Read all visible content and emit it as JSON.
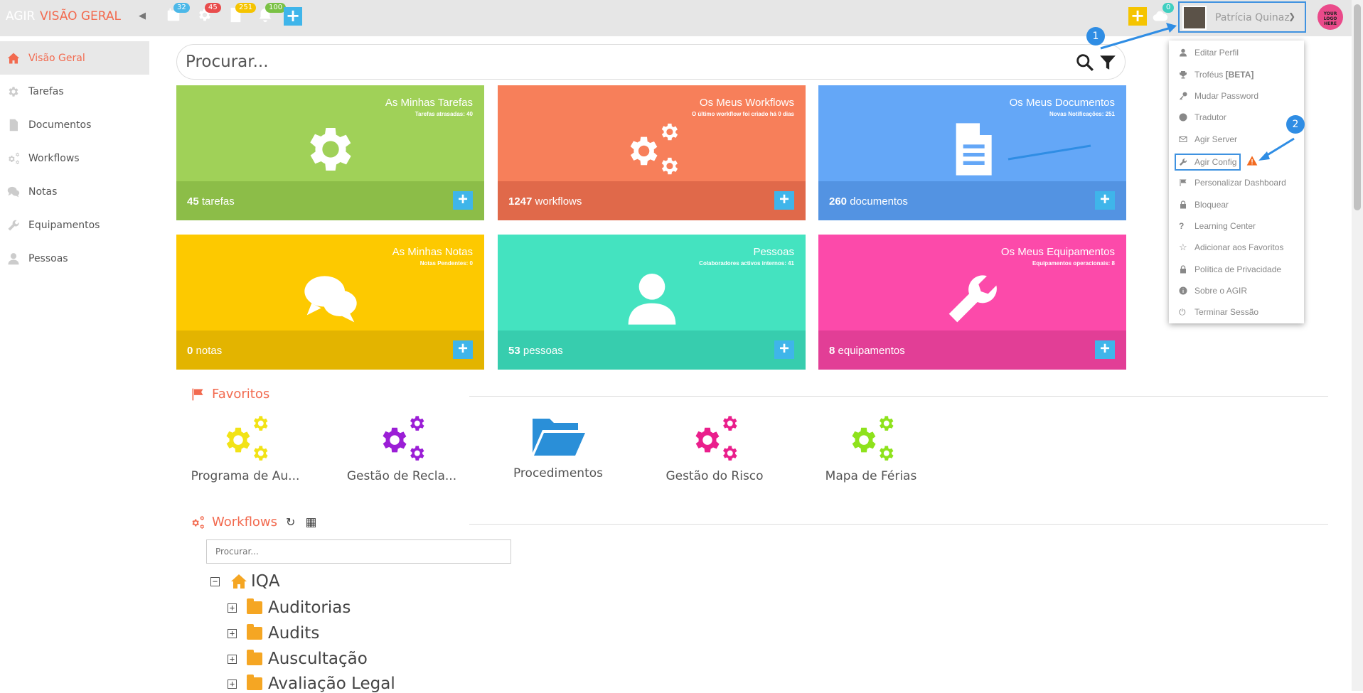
{
  "brand": {
    "app": "AGIR",
    "section": "VISÃO GERAL"
  },
  "topbar": {
    "badges": [
      {
        "icon": "calendar-icon",
        "count": "32",
        "color": "#4cb8e8"
      },
      {
        "icon": "gear-icon",
        "count": "45",
        "color": "#e84c4c"
      },
      {
        "icon": "document-icon",
        "count": "251",
        "color": "#f5c400"
      },
      {
        "icon": "bell-icon",
        "count": "100",
        "color": "#7ac144"
      }
    ],
    "cloud_count": "0",
    "user_name": "Patrícia Quinaz",
    "logo_text": "YOUR LOGO HERE"
  },
  "sidebar": {
    "items": [
      {
        "label": "Visão Geral",
        "icon": "home-icon"
      },
      {
        "label": "Tarefas",
        "icon": "gear-icon"
      },
      {
        "label": "Documentos",
        "icon": "document-icon"
      },
      {
        "label": "Workflows",
        "icon": "gears-icon"
      },
      {
        "label": "Notas",
        "icon": "comments-icon"
      },
      {
        "label": "Equipamentos",
        "icon": "wrench-icon"
      },
      {
        "label": "Pessoas",
        "icon": "user-icon"
      }
    ]
  },
  "search": {
    "placeholder": "Procurar..."
  },
  "tiles": [
    {
      "title": "As Minhas Tarefas",
      "subtitle": "Tarefas atrasadas: 40",
      "count": "45",
      "unit": "tarefas",
      "color": "#a0d158",
      "footer": "#8cbd48",
      "icon": "gear-icon"
    },
    {
      "title": "Os Meus Workflows",
      "subtitle": "O último workflow foi criado há 0 dias",
      "count": "1247",
      "unit": "workflows",
      "color": "#f77f5a",
      "footer": "#e0694a",
      "icon": "gears-icon"
    },
    {
      "title": "Os Meus Documentos",
      "subtitle": "Novas Notificações: 251",
      "count": "260",
      "unit": "documentos",
      "color": "#64a7f7",
      "footer": "#5393e2",
      "icon": "document-icon"
    },
    {
      "title": "As Minhas Notas",
      "subtitle": "Notas Pendentes: 0",
      "count": "0",
      "unit": "notas",
      "color": "#fdc900",
      "footer": "#e3b400",
      "icon": "comments-icon"
    },
    {
      "title": "Pessoas",
      "subtitle": "Colaboradores activos internos: 41",
      "count": "53",
      "unit": "pessoas",
      "color": "#44e3c0",
      "footer": "#37cdae",
      "icon": "user-icon"
    },
    {
      "title": "Os Meus Equipamentos",
      "subtitle": "Equipamentos operacionais: 8",
      "count": "8",
      "unit": "equipamentos",
      "color": "#fc4aaa",
      "footer": "#e23e96",
      "icon": "wrench-icon"
    }
  ],
  "favorites": {
    "heading": "Favoritos",
    "items": [
      {
        "label": "Programa de Au...",
        "color": "#f2e316",
        "icon": "gears-icon"
      },
      {
        "label": "Gestão de Recla...",
        "color": "#9b1ed6",
        "icon": "gears-icon"
      },
      {
        "label": "Procedimentos",
        "color": "#2a8fd8",
        "icon": "folder-open-icon"
      },
      {
        "label": "Gestão do Risco",
        "color": "#ea1f8c",
        "icon": "gears-icon"
      },
      {
        "label": "Mapa de Férias",
        "color": "#8ee21c",
        "icon": "gears-icon"
      }
    ]
  },
  "workflows": {
    "heading": "Workflows",
    "search_placeholder": "Procurar...",
    "root": "IQA",
    "children": [
      "Auditorias",
      "Audits",
      "Auscultação",
      "Avaliação Legal"
    ]
  },
  "user_menu": {
    "items": [
      {
        "label": "Editar Perfil",
        "icon": "user-icon"
      },
      {
        "label": "Troféus",
        "tag": "[BETA]",
        "icon": "trophy-icon"
      },
      {
        "label": "Mudar Password",
        "icon": "key-icon"
      },
      {
        "label": "Tradutor",
        "icon": "globe-icon"
      },
      {
        "label": "Agir Server",
        "icon": "mail-icon"
      },
      {
        "label": "Agir Config",
        "icon": "wrench-icon"
      },
      {
        "label": "Personalizar Dashboard",
        "icon": "flag-icon"
      },
      {
        "label": "Bloquear",
        "icon": "lock-icon"
      },
      {
        "label": "Learning Center",
        "icon": "question-icon"
      },
      {
        "label": "Adicionar aos Favoritos",
        "icon": "star-icon"
      },
      {
        "label": "Política de Privacidade",
        "icon": "lock-icon"
      },
      {
        "label": "Sobre o AGIR",
        "icon": "info-icon"
      },
      {
        "label": "Terminar Sessão",
        "icon": "power-icon"
      }
    ]
  },
  "callouts": [
    "1",
    "2"
  ]
}
